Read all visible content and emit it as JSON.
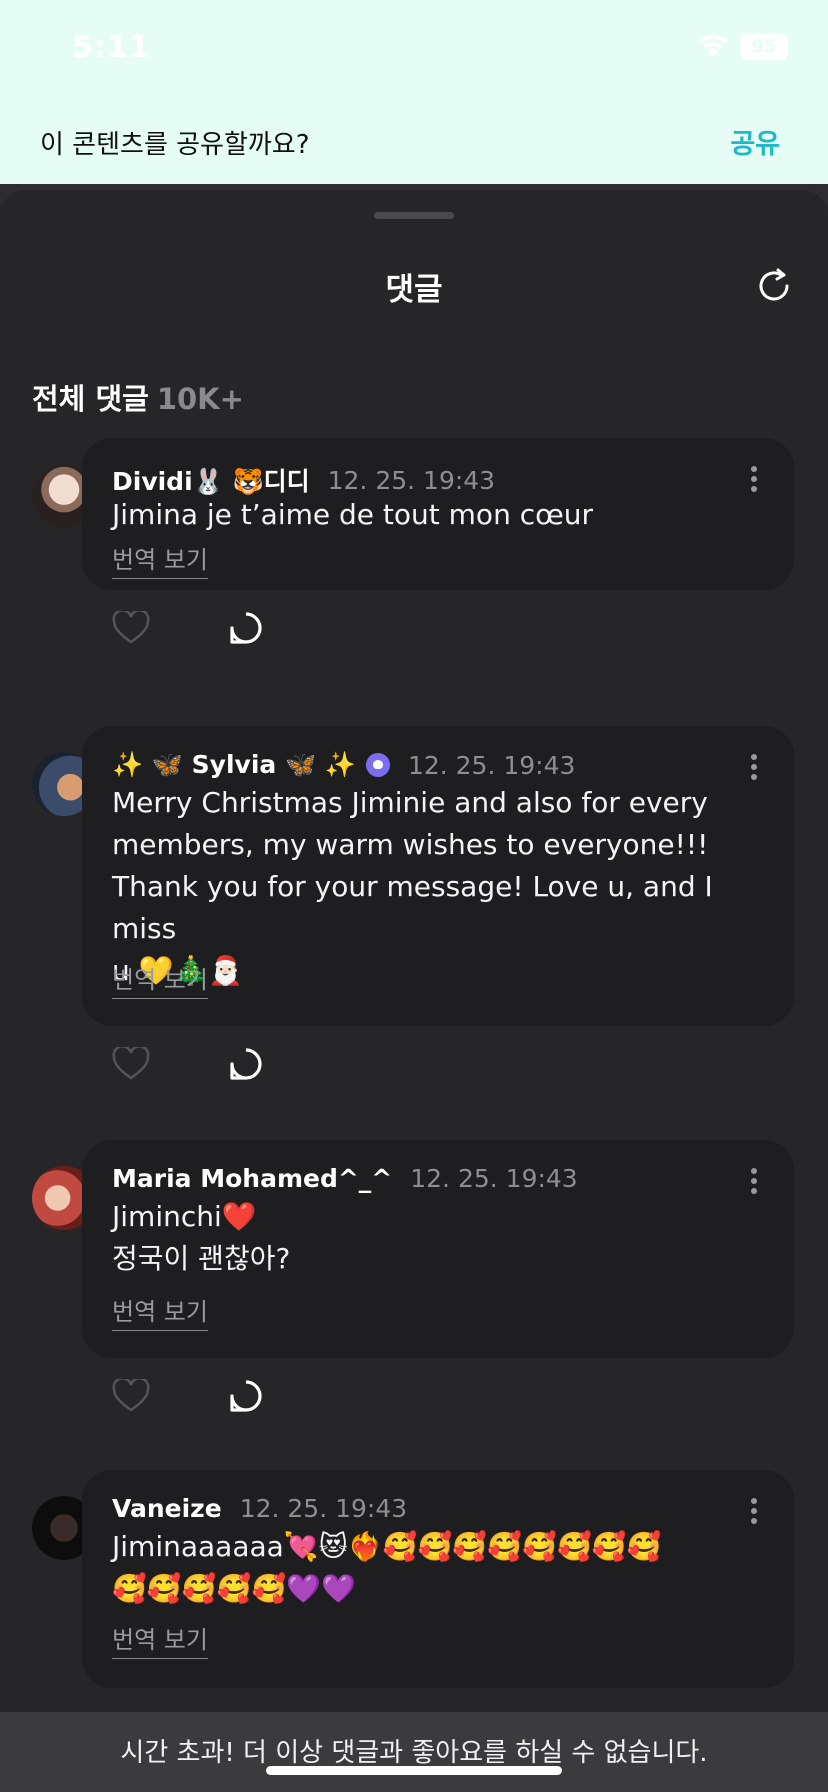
{
  "status_bar": {
    "time": "5:11",
    "battery": "95"
  },
  "banner": {
    "prompt": "이 콘텐츠를 공유할까요?",
    "share_label": "공유"
  },
  "sheet": {
    "title": "댓글",
    "section_title": "전체 댓글",
    "section_count": "10K+"
  },
  "comments": [
    {
      "author": "Dividi🐰 🐯디디",
      "time": "12. 25. 19:43",
      "text": "Jimina je t’aime de tout mon cœur",
      "translate": "번역 보기",
      "avatar_color": "#d9c2b6"
    },
    {
      "author": "✨ 🦋 Sylvia 🦋 ✨",
      "time": "12. 25. 19:43",
      "text": "Merry Christmas Jiminie and also for every\nmembers, my warm wishes to everyone!!!\nThank you for your message! Love u, and I miss\nu 💛🎄🎅🏻",
      "translate": "번역 보기",
      "avatar_color": "#6a7e9a"
    },
    {
      "author": "Maria Mohamed^_^",
      "time": "12. 25. 19:43",
      "text": "Jiminchi❤️\n정국이 괜찮아?",
      "translate": "번역 보기",
      "avatar_color": "#c04a3f"
    },
    {
      "author": "Vaneize",
      "time": "12. 25. 19:43",
      "text": "Jiminaaaaaa💘😻❤️‍🔥🥰🥰🥰🥰🥰🥰🥰🥰\n🥰🥰🥰🥰🥰💜💜",
      "translate": "번역 보기",
      "avatar_color": "#0d0d0d"
    }
  ],
  "toast": {
    "message": "시간 초과! 더 이상 댓글과 좋아요를 하실 수 없습니다."
  },
  "colors": {
    "accent": "#1fb9c6",
    "sheet_bg": "#262628",
    "bubble_bg": "#1e1e20"
  }
}
